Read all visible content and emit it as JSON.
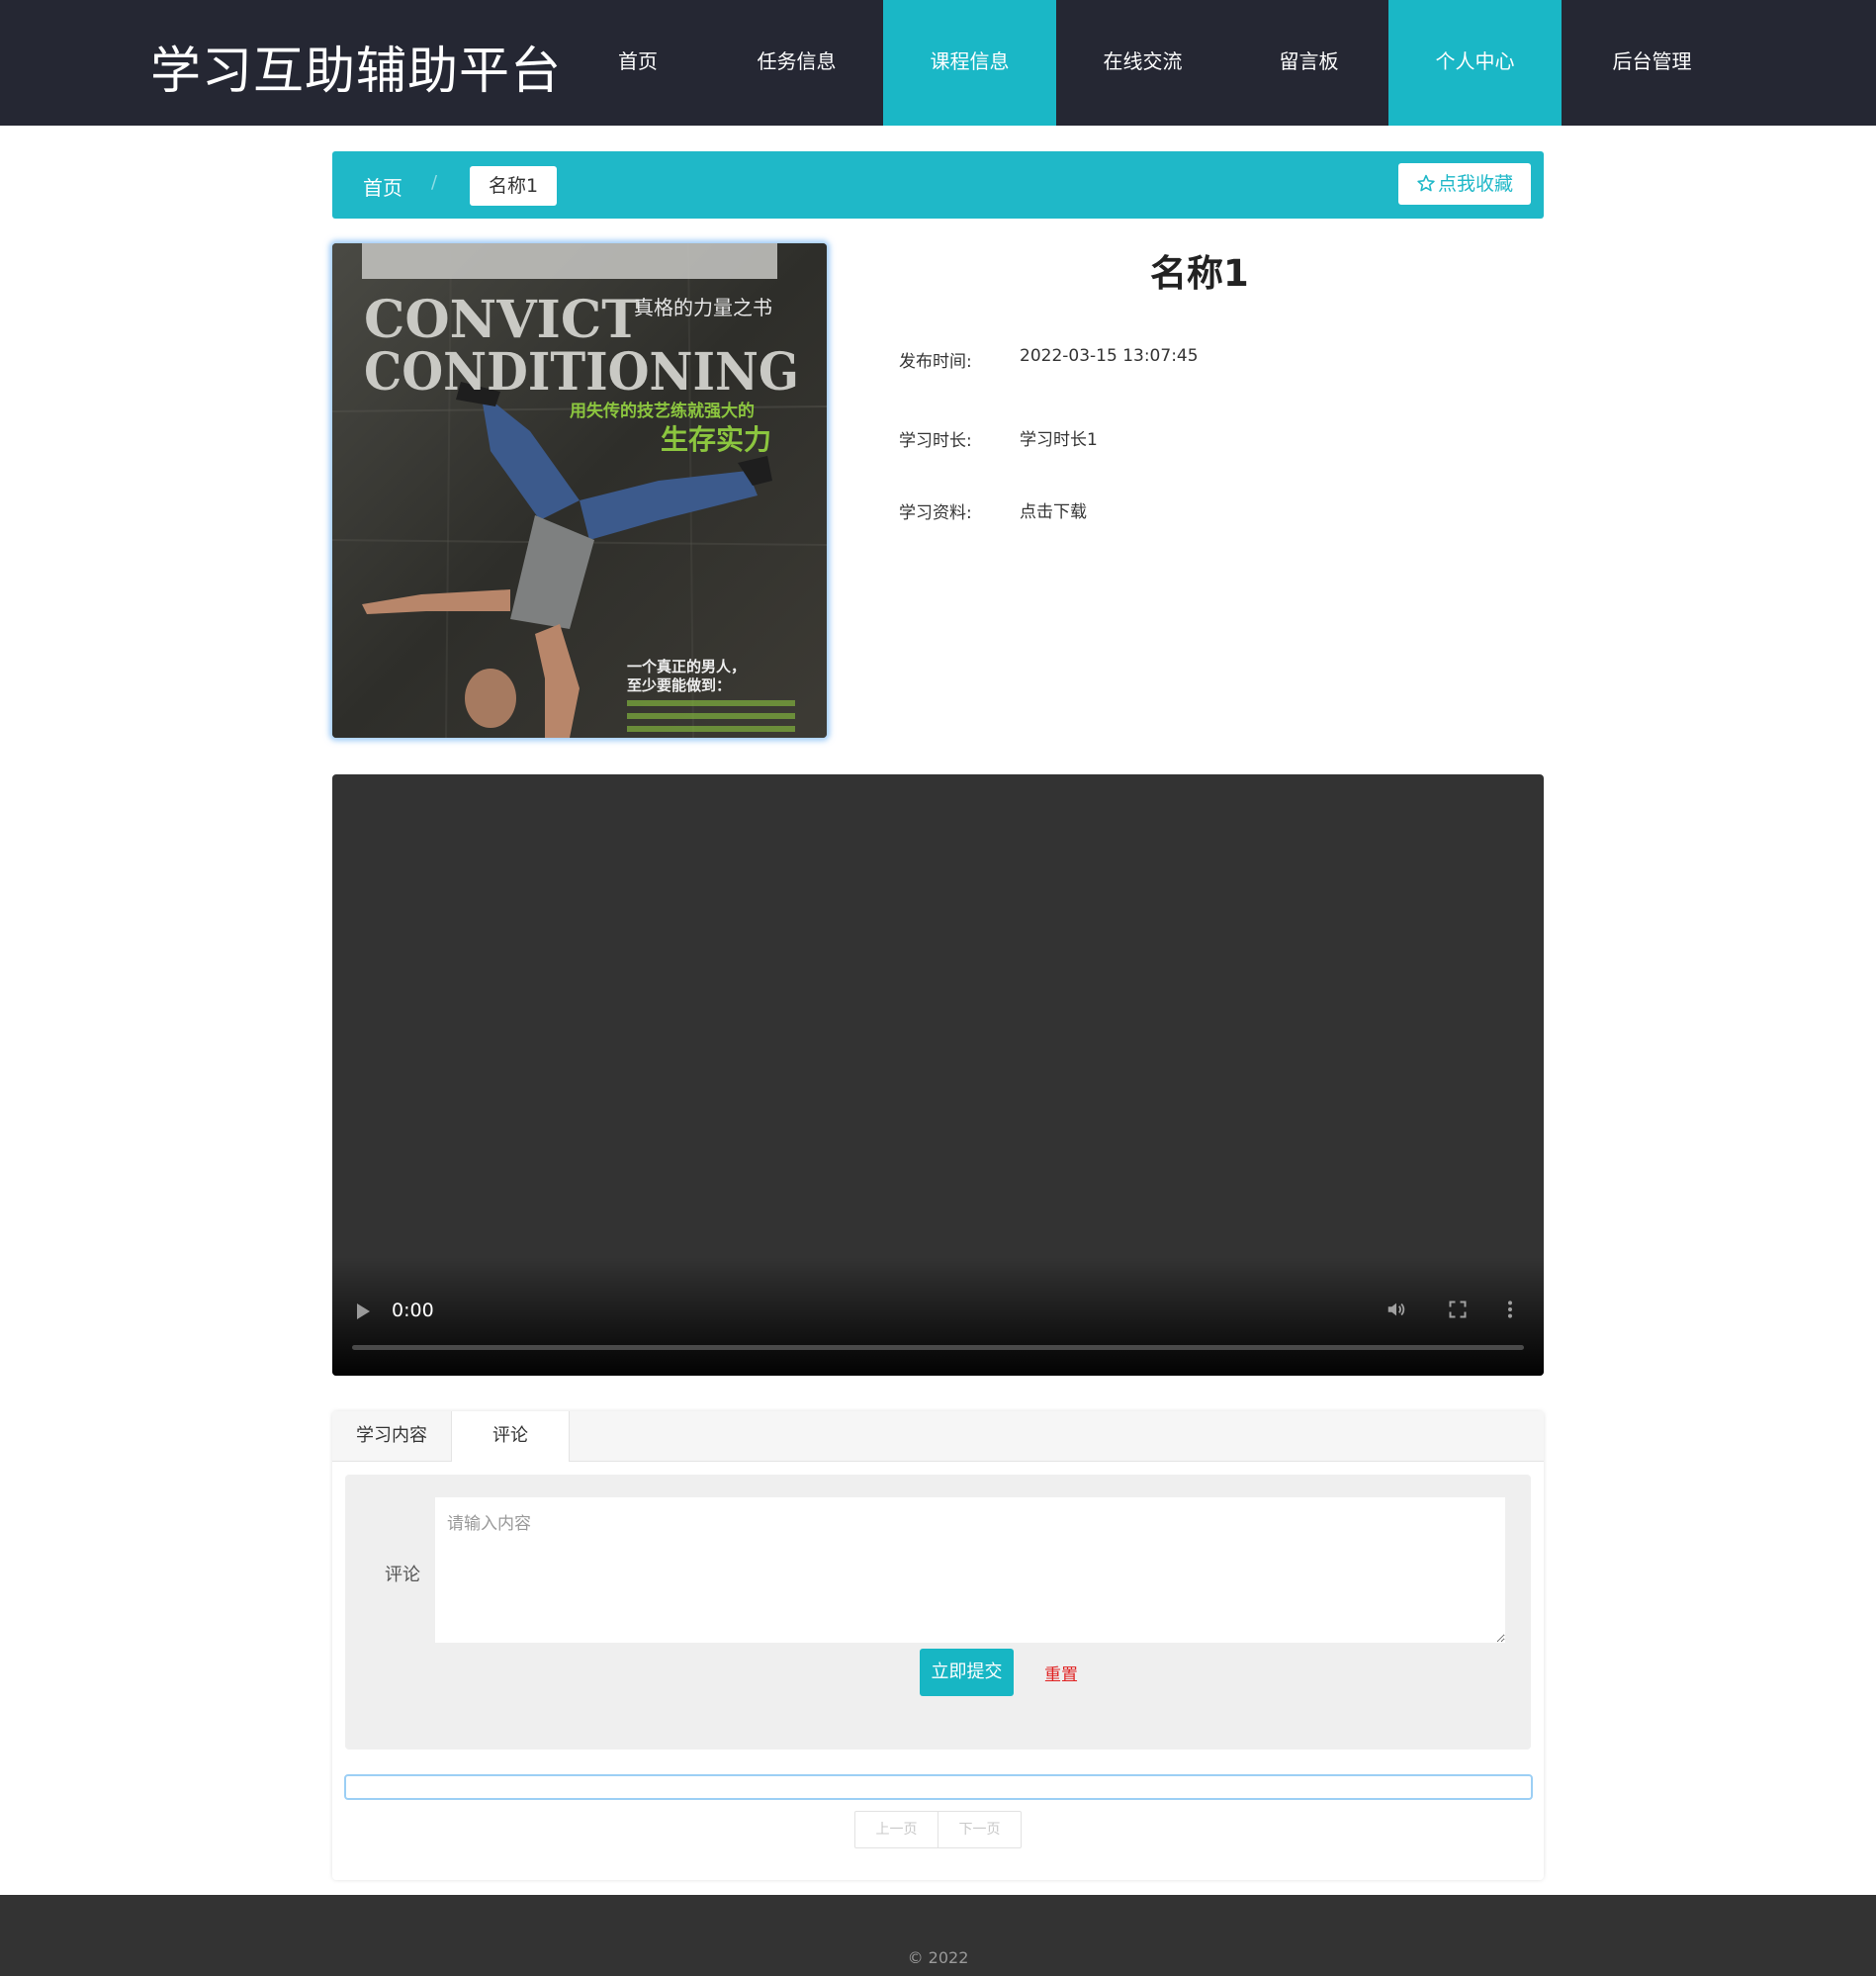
{
  "site": {
    "title": "学习互助辅助平台"
  },
  "nav": {
    "items": [
      {
        "label": "首页",
        "active": false
      },
      {
        "label": "任务信息",
        "active": false
      },
      {
        "label": "课程信息",
        "active": true
      },
      {
        "label": "在线交流",
        "active": false
      },
      {
        "label": "留言板",
        "active": false
      },
      {
        "label": "个人中心",
        "active": true
      },
      {
        "label": "后台管理",
        "active": false
      }
    ]
  },
  "breadcrumb": {
    "home": "首页",
    "separator": "/",
    "current": "名称1"
  },
  "favorite": {
    "label": "点我收藏",
    "icon": "star-outline-icon"
  },
  "cover": {
    "text_lines": [
      "CONVICT",
      "CONDITIONING",
      "真格的力量之书",
      "用失传的技艺练就强大的",
      "生存实力",
      "一个真正的男人，",
      "至少要能做到："
    ]
  },
  "detail": {
    "title": "名称1",
    "fields": [
      {
        "label": "发布时间:",
        "value": "2022-03-15 13:07:45"
      },
      {
        "label": "学习时长:",
        "value": "学习时长1"
      },
      {
        "label": "学习资料:",
        "value": "点击下载"
      }
    ]
  },
  "video": {
    "time": "0:00",
    "progress": 0
  },
  "tabs": [
    {
      "label": "学习内容",
      "active": false
    },
    {
      "label": "评论",
      "active": true
    }
  ],
  "comment_form": {
    "label": "评论",
    "placeholder": "请输入内容",
    "value": "",
    "submit_label": "立即提交",
    "reset_label": "重置"
  },
  "pager": {
    "prev": "上一页",
    "next": "下一页"
  },
  "footer": {
    "copyright": "© 2022"
  },
  "colors": {
    "header_bg": "#252733",
    "accent": "#1fb8c8",
    "reset": "#e02020",
    "footer_bg": "#333333"
  }
}
